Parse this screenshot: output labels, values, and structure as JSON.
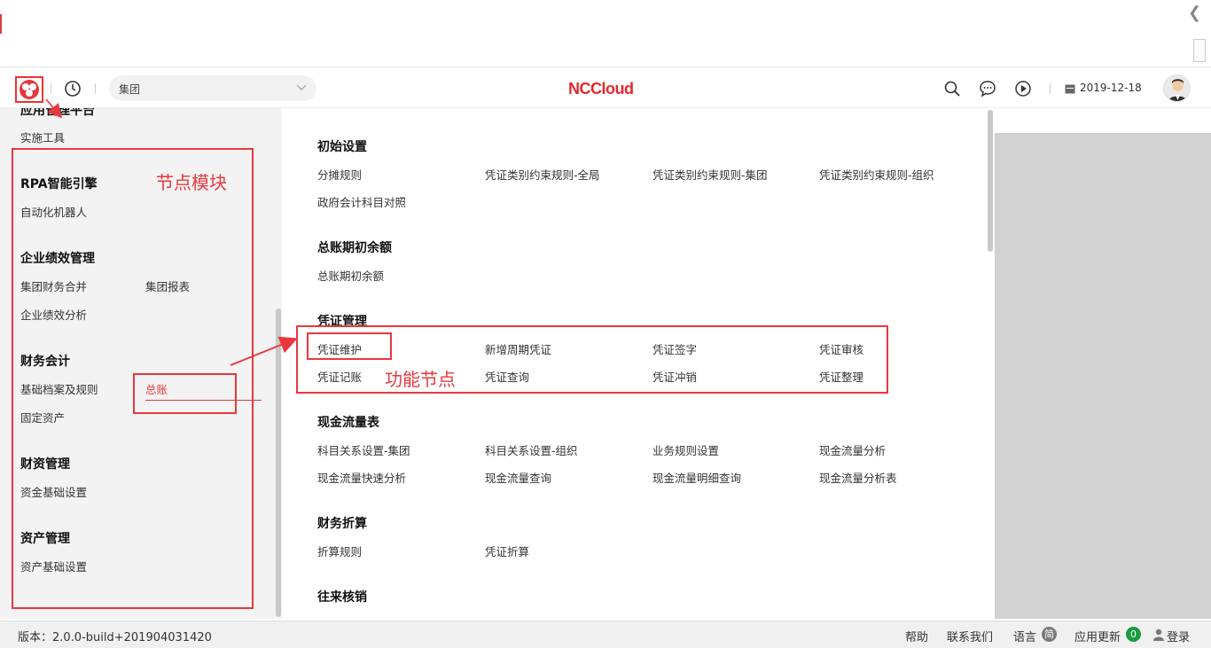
{
  "header": {
    "org_select": "集团",
    "brand": "NCCloud",
    "date": "2019-12-18"
  },
  "left_menu": {
    "partial_group": "应用管理平台",
    "groups": [
      {
        "title": "",
        "items": [
          "实施工具"
        ]
      },
      {
        "title": "RPA智能引擎",
        "items": [
          "自动化机器人"
        ]
      },
      {
        "title": "企业绩效管理",
        "items": [
          "集团财务合并",
          "集团报表",
          "企业绩效分析"
        ]
      },
      {
        "title": "财务会计",
        "items": [
          "基础档案及规则",
          "总账",
          "固定资产"
        ]
      },
      {
        "title": "财资管理",
        "items": [
          "资金基础设置"
        ]
      },
      {
        "title": "资产管理",
        "items": [
          "资产基础设置"
        ]
      }
    ],
    "active_item": "总账"
  },
  "sections": [
    {
      "title": "初始设置",
      "items": [
        "分摊规则",
        "凭证类别约束规则-全局",
        "凭证类别约束规则-集团",
        "凭证类别约束规则-组织",
        "政府会计科目对照"
      ]
    },
    {
      "title": "总账期初余额",
      "items": [
        "总账期初余额"
      ]
    },
    {
      "title": "凭证管理",
      "items": [
        "凭证维护",
        "新增周期凭证",
        "凭证签字",
        "凭证审核",
        "凭证记账",
        "凭证查询",
        "凭证冲销",
        "凭证整理"
      ]
    },
    {
      "title": "现金流量表",
      "items": [
        "科目关系设置-集团",
        "科目关系设置-组织",
        "业务规则设置",
        "现金流量分析",
        "现金流量快速分析",
        "现金流量查询",
        "现金流量明细查询",
        "现金流量分析表"
      ]
    },
    {
      "title": "财务折算",
      "items": [
        "折算规则",
        "凭证折算"
      ]
    },
    {
      "title": "往来核销",
      "items": []
    }
  ],
  "annotations": {
    "node_module": "节点模块",
    "function_node": "功能节点"
  },
  "footer": {
    "version": "版本：2.0.0-build+201904031420",
    "help": "帮助",
    "contact": "联系我们",
    "language": "语言",
    "language_badge": "简",
    "update": "应用更新",
    "update_count": "0",
    "login": "登录"
  }
}
